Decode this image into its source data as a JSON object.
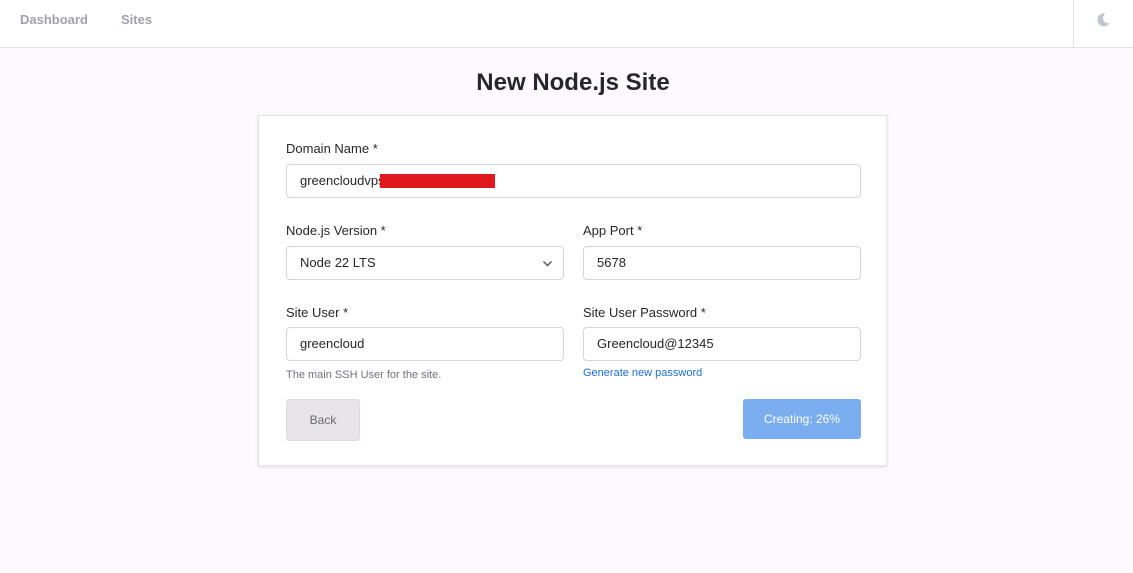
{
  "nav": {
    "items": [
      {
        "label": "Dashboard"
      },
      {
        "label": "Sites"
      }
    ],
    "theme_toggle_icon": "moon-icon"
  },
  "page": {
    "title": "New Node.js Site"
  },
  "form": {
    "domain": {
      "label": "Domain Name *",
      "value": "greencloudvps"
    },
    "node_version": {
      "label": "Node.js Version *",
      "value": "Node 22 LTS",
      "icon": "chevron-down-icon"
    },
    "app_port": {
      "label": "App Port *",
      "value": "5678"
    },
    "site_user": {
      "label": "Site User *",
      "value": "greencloud",
      "helper": "The main SSH User for the site."
    },
    "site_user_password": {
      "label": "Site User Password *",
      "value": "Greencloud@12345",
      "link": "Generate new password"
    },
    "back_label": "Back",
    "submit_label": "Creating: 26%",
    "progress_percent": 26
  },
  "colors": {
    "accent": "#7aaef0",
    "link": "#1e6fd0",
    "redaction": "#e0191c"
  }
}
